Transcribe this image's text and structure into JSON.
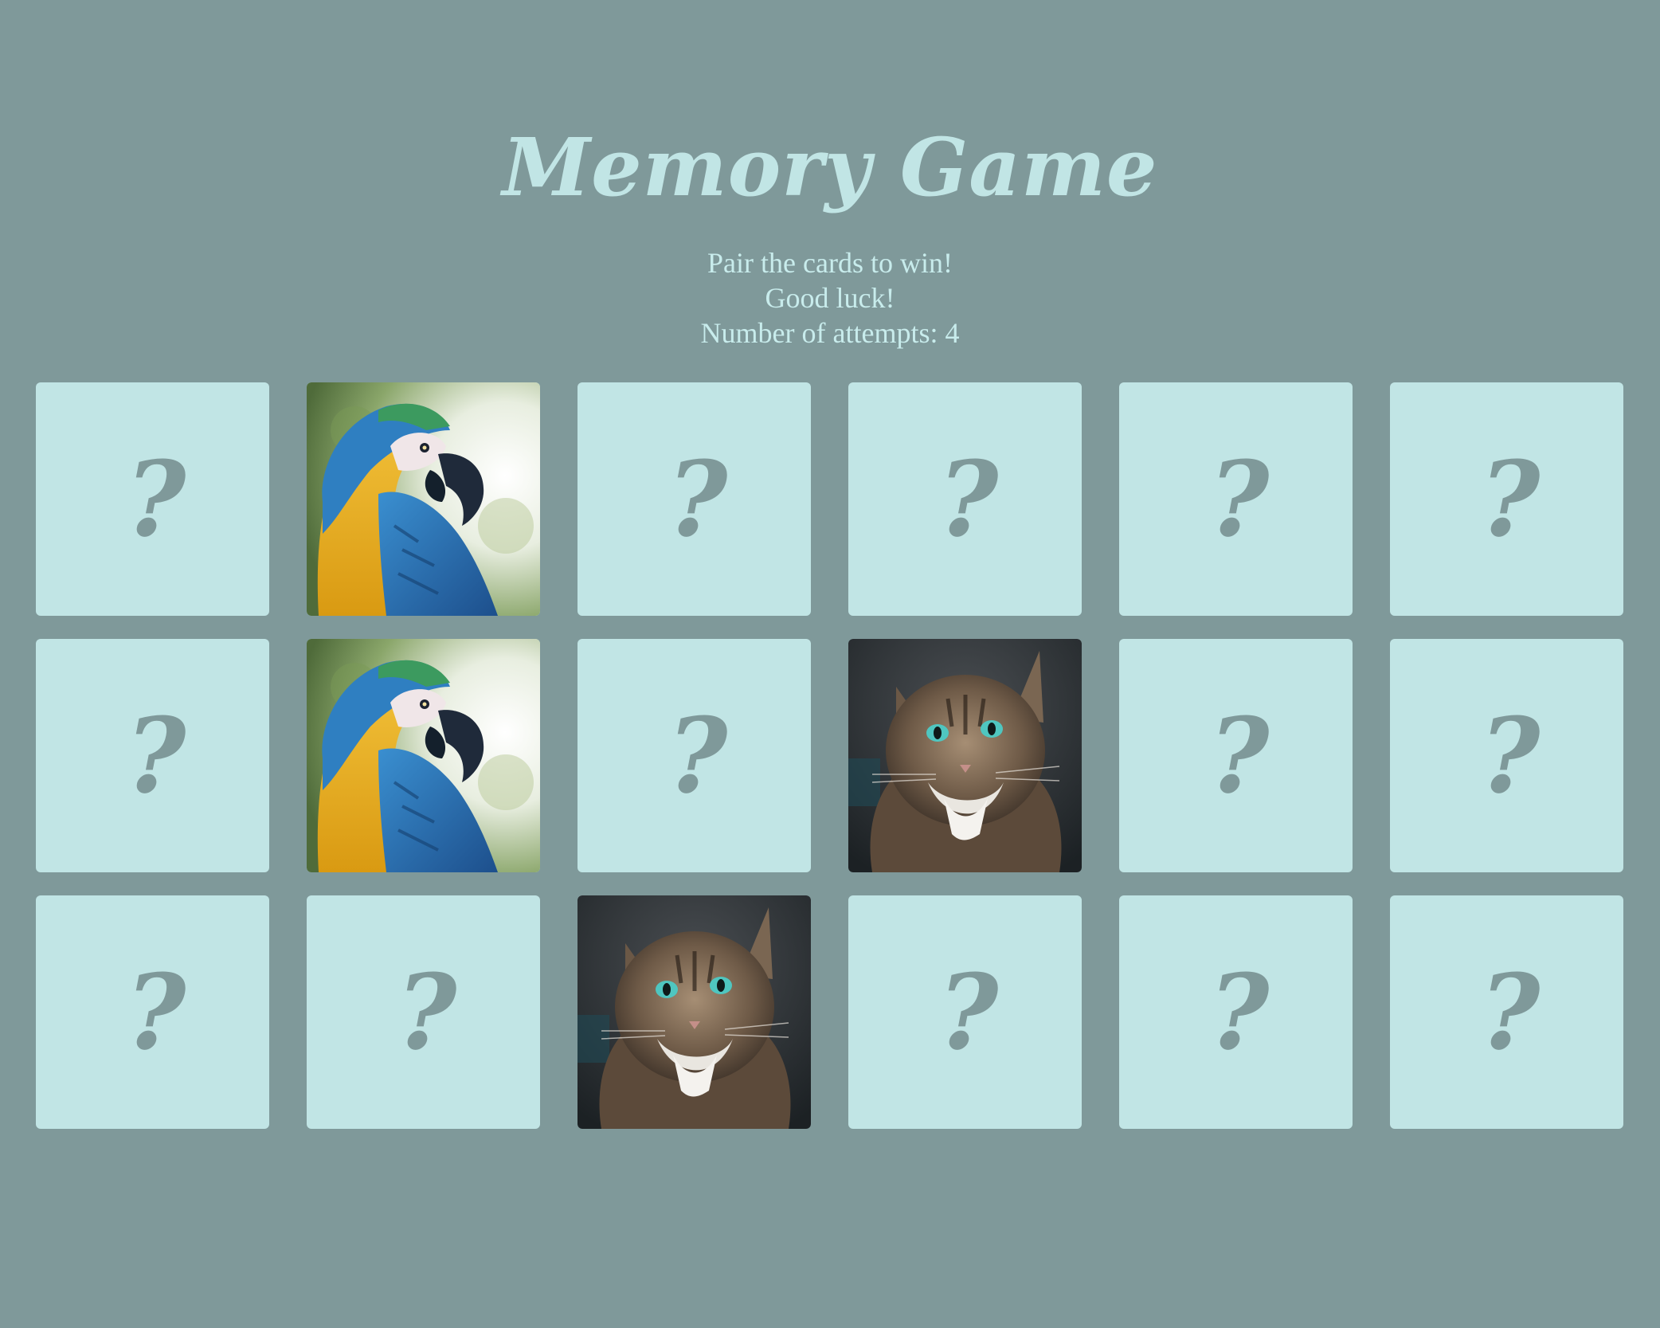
{
  "game": {
    "title": "Memory Game",
    "instructions": "Pair the cards to win!",
    "wish": "Good luck!",
    "attempts_label": "Number of attempts: 4"
  },
  "colors": {
    "background": "#7f999a",
    "card_back": "#c1e5e5",
    "text": "#c8ecec"
  },
  "cards": [
    {
      "state": "hidden",
      "symbol": "?"
    },
    {
      "state": "revealed",
      "image": "parrot"
    },
    {
      "state": "hidden",
      "symbol": "?"
    },
    {
      "state": "hidden",
      "symbol": "?"
    },
    {
      "state": "hidden",
      "symbol": "?"
    },
    {
      "state": "hidden",
      "symbol": "?"
    },
    {
      "state": "hidden",
      "symbol": "?"
    },
    {
      "state": "revealed",
      "image": "parrot"
    },
    {
      "state": "hidden",
      "symbol": "?"
    },
    {
      "state": "revealed",
      "image": "cat"
    },
    {
      "state": "hidden",
      "symbol": "?"
    },
    {
      "state": "hidden",
      "symbol": "?"
    },
    {
      "state": "hidden",
      "symbol": "?"
    },
    {
      "state": "hidden",
      "symbol": "?"
    },
    {
      "state": "revealed",
      "image": "cat"
    },
    {
      "state": "hidden",
      "symbol": "?"
    },
    {
      "state": "hidden",
      "symbol": "?"
    },
    {
      "state": "hidden",
      "symbol": "?"
    }
  ]
}
